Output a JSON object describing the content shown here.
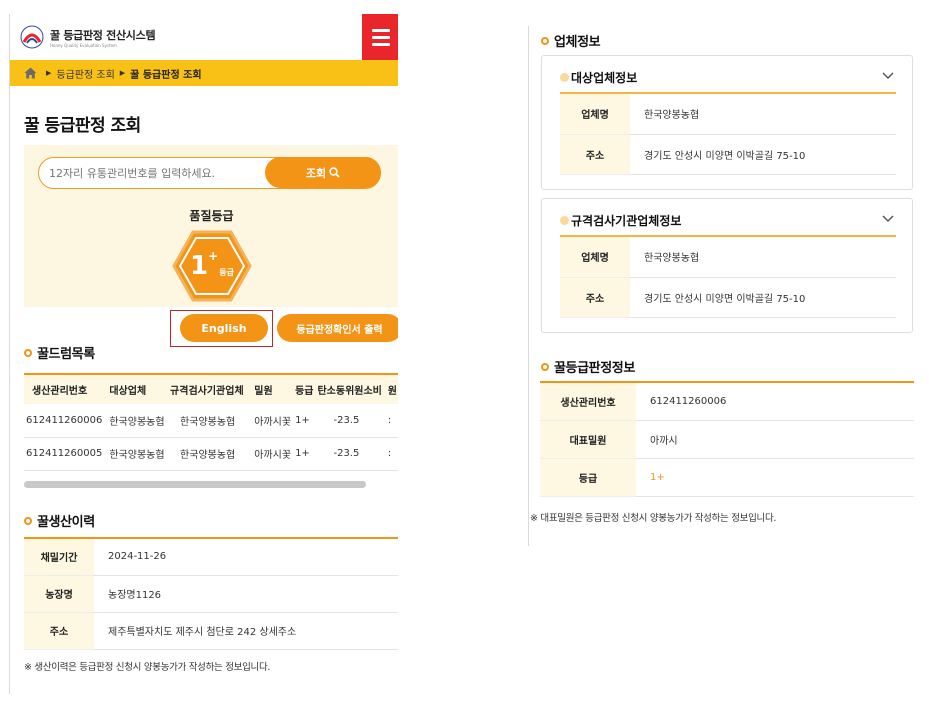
{
  "header": {
    "brand_title": "꿀 등급판정 전산시스템",
    "brand_sub": "Honey Quality Evaluation System",
    "menu_icon": "hamburger-icon"
  },
  "breadcrumb": {
    "home_icon": "home-icon",
    "items": [
      "등급판정 조회",
      "꿀 등급판정 조회"
    ]
  },
  "page": {
    "title": "꿀 등급판정 조회"
  },
  "search": {
    "placeholder": "12자리 유통관리번호를 입력하세요.",
    "button_label": "조회",
    "button_icon": "search-icon"
  },
  "quality": {
    "label": "품질등급",
    "grade": "1",
    "grade_sup": "+",
    "grade_unit": "등급"
  },
  "buttons": {
    "english": "English",
    "certificate": "등급판정확인서 출력"
  },
  "honey_list": {
    "title": "꿀드럼목록",
    "columns": [
      "생산관리번호",
      "대상업체",
      "규격검사기관업체",
      "밀원",
      "등급",
      "탄소동위원소비",
      "원"
    ],
    "rows": [
      [
        "612411260006",
        "한국양봉농협",
        "한국양봉농협",
        "아까시꽃",
        "1+",
        "-23.5",
        ":"
      ],
      [
        "612411260005",
        "한국양봉농협",
        "한국양봉농협",
        "아까시꽃",
        "1+",
        "-23.5",
        ":"
      ]
    ]
  },
  "production_history": {
    "title": "꿀생산이력",
    "rows": [
      {
        "label": "채밀기간",
        "value": "2024-11-26"
      },
      {
        "label": "농장명",
        "value": "농장명1126"
      },
      {
        "label": "주소",
        "value": "제주특별자치도 제주시 첨단로 242 상세주소"
      }
    ],
    "note": "※ 생산이력은 등급판정 신청시 양봉농가가 작성하는 정보입니다."
  },
  "company_info": {
    "title": "업체정보",
    "cards": [
      {
        "title": "대상업체정보",
        "rows": [
          {
            "label": "업체명",
            "value": "한국양봉농협"
          },
          {
            "label": "주소",
            "value": "경기도 안성시 미양면 이박골길 75-10"
          }
        ]
      },
      {
        "title": "규격검사기관업체정보",
        "rows": [
          {
            "label": "업체명",
            "value": "한국양봉농협"
          },
          {
            "label": "주소",
            "value": "경기도 안성시 미양면 이박골길 75-10"
          }
        ]
      }
    ]
  },
  "grade_info": {
    "title": "꿀등급판정정보",
    "rows": [
      {
        "label": "생산관리번호",
        "value": "612411260006"
      },
      {
        "label": "대표밀원",
        "value": "아까시"
      },
      {
        "label": "등급",
        "value": "1+"
      }
    ],
    "note": "※ 대표밀원은 등급판정 신청시 양봉농가가 작성하는 정보입니다."
  },
  "colors": {
    "accent": "#f39416",
    "breadcrumb_bg": "#f9c116",
    "menu_red": "#e8262b",
    "panel_bg": "#fdf7e1"
  }
}
